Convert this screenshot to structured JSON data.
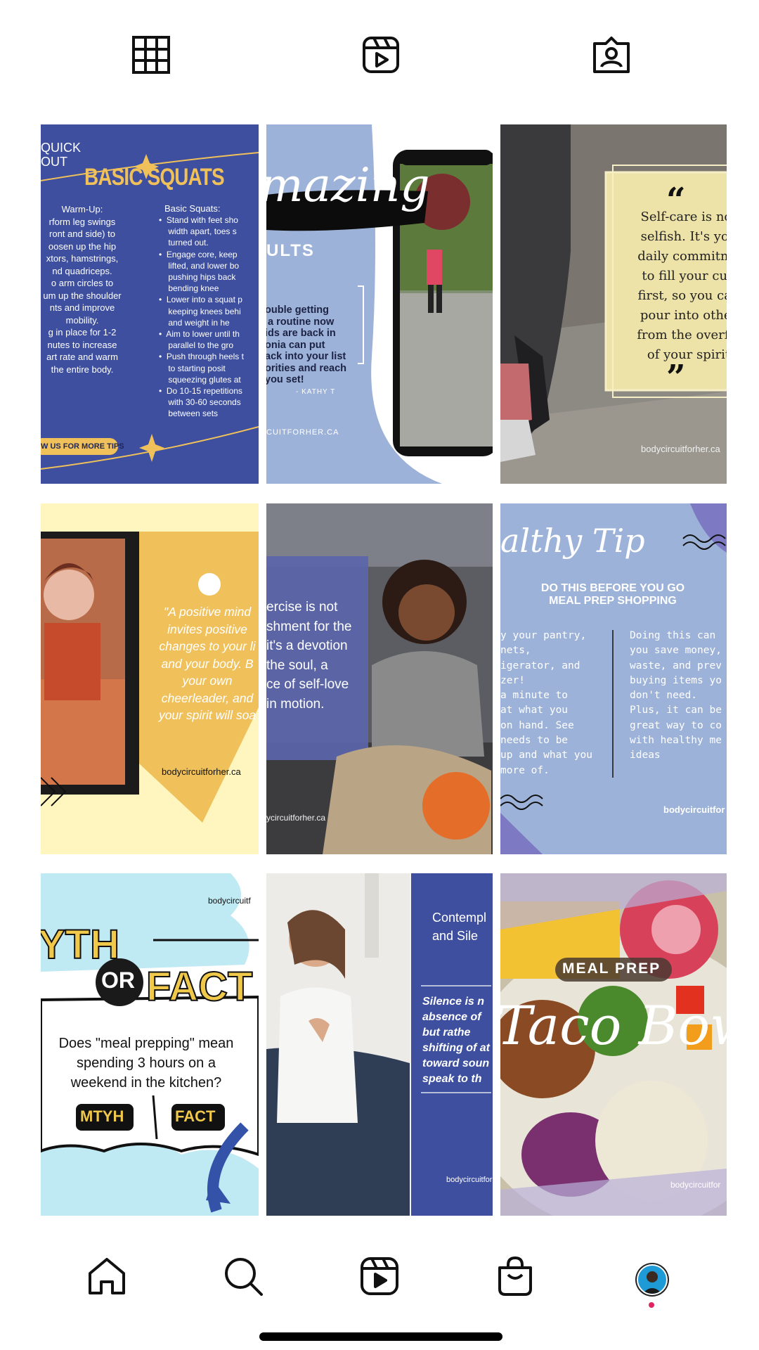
{
  "profile_tabs": [
    {
      "name": "grid-icon",
      "label": "Posts"
    },
    {
      "name": "reels-icon",
      "label": "Reels"
    },
    {
      "name": "tagged-icon",
      "label": "Tagged"
    }
  ],
  "posts": {
    "p1": {
      "title": "BASIC SQUATS",
      "corner": "QUICK\nOUT",
      "warmup": "Warm-Up:\nrform leg swings\nront and side) to\noosen up the hip\nxtors, hamstrings,\nnd quadriceps.\no arm circles to\num up the shoulder\nnts and improve\nmobility.\ng in place for 1-2\nnutes to increase\nart rate and warm\nthe entire body.",
      "steps_heading": "Basic Squats:",
      "steps": "•  Stand with feet sho\n    width apart, toes s\n    turned out.\n•  Engage core, keep\n    lifted, and lower bo\n    pushing hips back\n    bending knee\n•  Lower into a squat p\n    keeping knees behi\n    and weight in he\n•  Aim to lower until th\n    parallel to the gro\n•  Push through heels t\n    to starting posit\n    squeezing glutes at\n•  Do 10-15 repetitions\n    with 30-60 seconds\n    between sets",
      "cta": "W US FOR MORE TIPS"
    },
    "p2": {
      "script": "mazing",
      "sub": "ULTS",
      "quote": "ouble getting\n a routine now\nids are back in\nonia can put\nack into your list\norities and reach\nyou set!",
      "author": "- KATHY T",
      "site": "CUITFORHER.CA"
    },
    "p3": {
      "quote": "Self-care is not\nselfish. It's you\ndaily commitme\nto fill your cup\nfirst, so you can\npour into other\nfrom the overflo\nof your spirit",
      "site": "bodycircuitforher.ca"
    },
    "p4": {
      "quote": "\"A positive mind\ninvites positive\nchanges to your li\nand your body. B\nyour own\ncheerleader, and\nyour spirit will soa",
      "site": "bodycircuitforher.ca"
    },
    "p5": {
      "quote": "ercise is not\nshment for the\nit's a devotion\nthe soul, a\nce of self-love\nin motion.",
      "site": "ycircuitforher.ca"
    },
    "p6": {
      "script": "althy Tip",
      "heading": "DO THIS BEFORE YOU GO\nMEAL PREP SHOPPING",
      "left": "y your pantry,\nnets,\nigerator, and\nzer!\na minute to\nat what you\non hand. See\nneeds to be\nup and what you\nmore of.",
      "right": "Doing this can\nyou save money,\nwaste, and prev\nbuying items yo\ndon't need.\nPlus, it can be\ngreat way to co\nwith healthy me\nideas",
      "site": "bodycircuitfor"
    },
    "p7": {
      "site": "bodycircuitf",
      "myth": "YTH",
      "or": "OR",
      "fact": "FACT",
      "question": "Does \"meal prepping\" mean spending 3 hours on a weekend in the kitchen?",
      "btn_myth": "MTYH",
      "btn_fact": "FACT"
    },
    "p8": {
      "title": "Contempl\nand Sile",
      "quote": "Silence is n\nabsence of\nbut rathe\nshifting of at\ntoward soun\nspeak to th",
      "site": "bodycircuitfor"
    },
    "p9": {
      "badge": "MEAL PREP",
      "script": "Taco Bow",
      "site": "bodycircuitfor"
    }
  },
  "bottom_nav": [
    {
      "name": "home-icon",
      "label": "Home"
    },
    {
      "name": "search-icon",
      "label": "Search"
    },
    {
      "name": "reels-icon",
      "label": "Reels"
    },
    {
      "name": "shop-icon",
      "label": "Shop"
    },
    {
      "name": "profile-avatar",
      "label": "Profile"
    }
  ],
  "colors": {
    "royal_blue": "#3d4f9e",
    "periwinkle": "#9db2d8",
    "mustard": "#f0c15a",
    "cream": "#fff6bf",
    "gold": "#f0c84a",
    "sky": "#bfe9f3"
  }
}
